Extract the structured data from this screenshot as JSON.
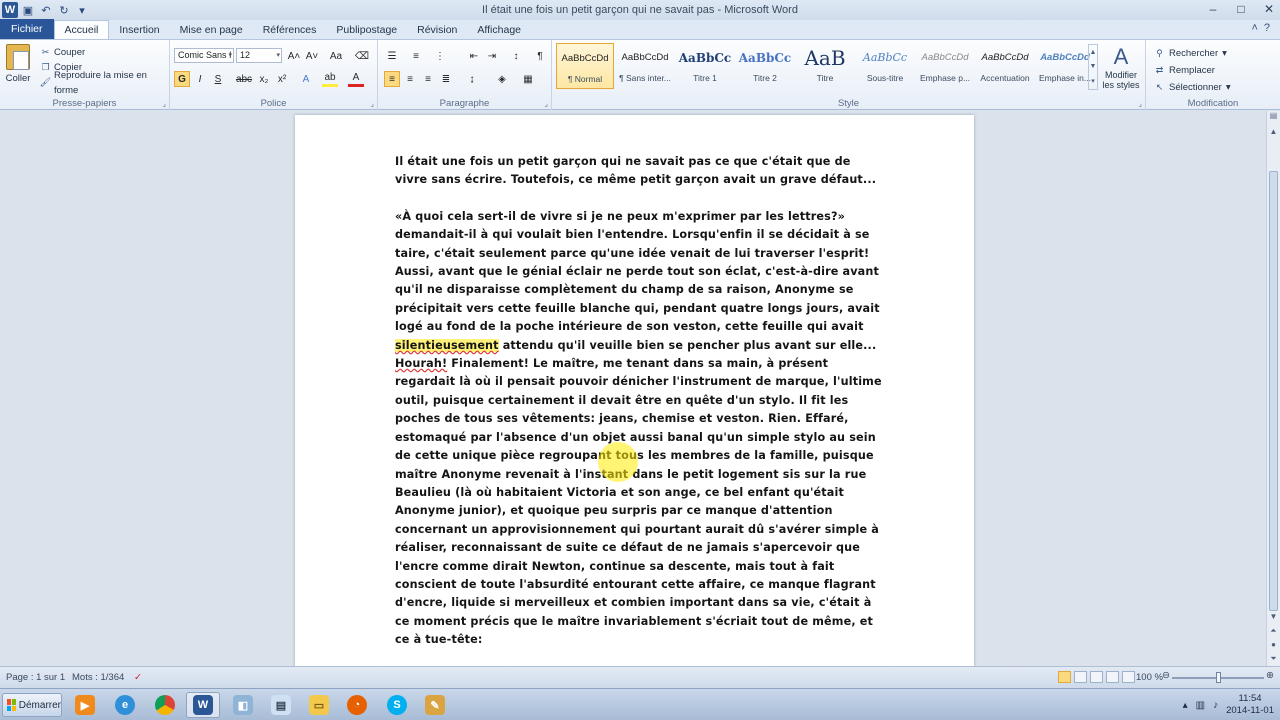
{
  "window": {
    "title": "Il était une fois un petit garçon qui ne savait pas - Microsoft Word",
    "qat_icons": [
      "save-icon",
      "undo-icon",
      "redo-icon",
      "customize-icon"
    ]
  },
  "tabs": [
    "Fichier",
    "Accueil",
    "Insertion",
    "Mise en page",
    "Références",
    "Publipostage",
    "Révision",
    "Affichage"
  ],
  "active_tab": "Accueil",
  "ribbon": {
    "clipboard": {
      "paste": "Coller",
      "cut": "Couper",
      "copy": "Copier",
      "format_painter": "Reproduire la mise en forme",
      "label": "Presse-papiers"
    },
    "font": {
      "name": "Comic Sans I",
      "size": "12",
      "label": "Police",
      "bold": "G",
      "italic": "I",
      "underline": "S"
    },
    "paragraph": {
      "label": "Paragraphe"
    },
    "styles": {
      "label": "Style",
      "items": [
        {
          "sample": "AaBbCcDd",
          "name": "¶ Normal"
        },
        {
          "sample": "AaBbCcDd",
          "name": "¶ Sans inter..."
        },
        {
          "sample": "AaBbCc",
          "name": "Titre 1"
        },
        {
          "sample": "AaBbCc",
          "name": "Titre 2"
        },
        {
          "sample": "AaB",
          "name": "Titre"
        },
        {
          "sample": "AaBbCc",
          "name": "Sous-titre"
        },
        {
          "sample": "AaBbCcDd",
          "name": "Emphase p..."
        },
        {
          "sample": "AaBbCcDd",
          "name": "Accentuation"
        },
        {
          "sample": "AaBbCcDd",
          "name": "Emphase in..."
        }
      ],
      "modify_line1": "Modifier",
      "modify_line2": "les styles"
    },
    "editing": {
      "find": "Rechercher",
      "replace": "Remplacer",
      "select": "Sélectionner",
      "label": "Modification"
    }
  },
  "document": {
    "p1": "Il était une fois un petit garçon qui ne savait  pas ce que c'était que de vivre sans écrire. Toutefois, ce même petit garçon avait un grave défaut...",
    "p2_before": "«À quoi cela sert-il de vivre si je ne peux m'exprimer par les lettres?» demandait-il à qui voulait bien l'entendre. Lorsqu'enfin il se décidait à se taire, c'était seulement parce qu'une idée venait de lui traverser l'esprit! Aussi, avant que le génial éclair ne perde tout son éclat, c'est-à-dire avant qu'il ne disparaisse complètement du champ de sa raison, Anonyme se précipitait vers cette feuille blanche qui, pendant quatre longs jours, avait logé au fond de la poche intérieure de son veston, cette feuille qui avait ",
    "p2_word1": "silentieusement",
    "p2_mid": " attendu qu'il veuille bien se pencher plus avant sur elle... ",
    "p2_word2": "Hourah!",
    "p2_after": " Finalement! Le maître, me tenant dans sa main, à présent regardait là où il pensait pouvoir dénicher l'instrument de marque, l'ultime outil, puisque certainement il devait être en quête d'un stylo. Il fit les poches de tous ses vêtements: jeans, chemise et veston. Rien. Effaré, estomaqué par l'absence d'un objet aussi banal qu'un simple stylo au sein de cette unique pièce regroupant tous les membres de la famille, puisque maître Anonyme revenait à l'instant dans le petit logement sis sur la rue Beaulieu (là où habitaient Victoria et son ange, ce bel enfant qu'était Anonyme junior), et quoique peu surpris par ce manque d'attention concernant un approvisionnement qui pourtant aurait dû s'avérer simple à réaliser, reconnaissant de suite ce défaut de ne jamais s'apercevoir que l'encre comme dirait Newton, continue sa descente, mais tout à fait conscient de toute l'absurdité entourant cette affaire, ce manque flagrant d'encre, liquide si merveilleux et combien important dans sa vie, c'était à ce moment précis que le maître invariablement s'écriait tout de même, et ce à tue-tête:"
  },
  "status": {
    "page": "Page : 1 sur 1",
    "words": "Mots : 1/364",
    "zoom": "100 %"
  },
  "taskbar": {
    "start": "Démarrer",
    "apps": [
      "media-player-icon",
      "ie-icon",
      "chrome-icon",
      "word-icon",
      "app-icon",
      "notepad-icon",
      "folder-icon",
      "firefox-icon",
      "skype-icon",
      "paint-icon"
    ],
    "time": "11:54",
    "date": "2014-11-01"
  },
  "colors": {
    "file_tab": "#2a5699",
    "highlight": "#fbd97e",
    "style_selected": "#fde7a4"
  }
}
